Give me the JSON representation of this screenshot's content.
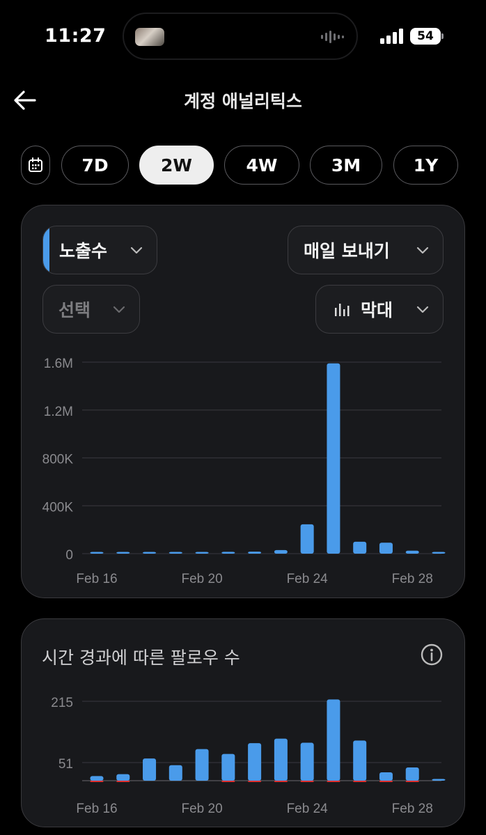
{
  "status_bar": {
    "time": "11:27",
    "battery": "54"
  },
  "header": {
    "title": "계정 애널리틱스"
  },
  "ranges": [
    "7D",
    "2W",
    "4W",
    "3M",
    "1Y"
  ],
  "active_range": "2W",
  "controls": {
    "metric": "노출수",
    "interval": "매일 보내기",
    "compare": "선택",
    "chart_type": "막대"
  },
  "colors": {
    "bar": "#4a9bea",
    "negative": "#e0312f",
    "accent": "#4a9bea"
  },
  "follow_title": "시간 경과에 따른 팔로우 수",
  "chart_data": [
    {
      "type": "bar",
      "title": "",
      "x": [
        "Feb 16",
        "Feb 17",
        "Feb 18",
        "Feb 19",
        "Feb 20",
        "Feb 21",
        "Feb 22",
        "Feb 23",
        "Feb 24",
        "Feb 25",
        "Feb 26",
        "Feb 27",
        "Feb 28",
        "Mar 1"
      ],
      "x_tick_labels": [
        "Feb 16",
        "Feb 20",
        "Feb 24",
        "Feb 28"
      ],
      "y_tick_labels": [
        "0",
        "400K",
        "800K",
        "1.2M",
        "1.6M"
      ],
      "ylim": [
        0,
        1600000
      ],
      "series": [
        {
          "values": [
            5000,
            6000,
            8000,
            9000,
            12000,
            15000,
            17000,
            30000,
            245000,
            1590000,
            100000,
            92000,
            25000,
            8000
          ]
        }
      ],
      "grid": true
    },
    {
      "type": "bar",
      "title": "",
      "x": [
        "Feb 16",
        "Feb 17",
        "Feb 18",
        "Feb 19",
        "Feb 20",
        "Feb 21",
        "Feb 22",
        "Feb 23",
        "Feb 24",
        "Feb 25",
        "Feb 26",
        "Feb 27",
        "Feb 28",
        "Mar 1"
      ],
      "x_tick_labels": [
        "Feb 16",
        "Feb 20",
        "Feb 24",
        "Feb 28"
      ],
      "y_tick_labels": [
        "51",
        "215"
      ],
      "series": [
        {
          "values": [
            15,
            20,
            62,
            44,
            87,
            74,
            103,
            115,
            104,
            220,
            110,
            25,
            38,
            5
          ]
        },
        {
          "values": [
            -2,
            -2,
            0,
            0,
            0,
            -1,
            -3,
            -3,
            -2,
            -4,
            -5,
            -2,
            -2,
            0
          ]
        }
      ],
      "grid": true
    }
  ]
}
